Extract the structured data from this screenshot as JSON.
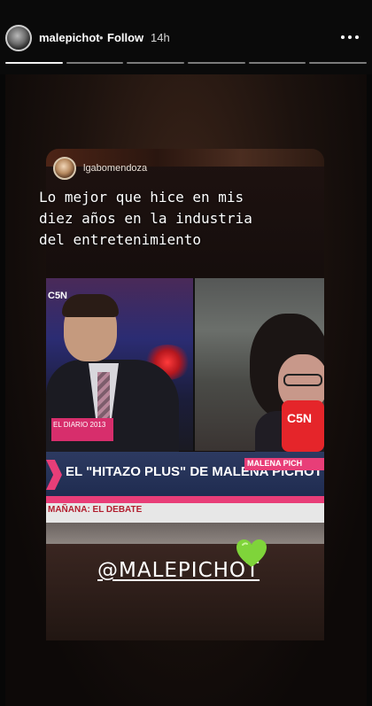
{
  "header": {
    "username": "malepichot",
    "separator": "•",
    "follow_label": "Follow",
    "time_ago": "14h",
    "more_icon": "ellipsis-horizontal-icon"
  },
  "progress": {
    "segments": 6,
    "active_index": 0
  },
  "story": {
    "shared_post": {
      "username": "lgabomendoza",
      "caption_lines": [
        "Lo mejor que hice en mis",
        "diez años en la industria",
        "del entretenimiento"
      ]
    },
    "tv": {
      "channel_logo": "C5N",
      "mic_logo": "C5N",
      "date_label": "EL DIARIO 2013",
      "name_label": "MALENA PICH",
      "headline": "EL \"HITAZO PLUS\" DE MALENA PICHOT",
      "ticker": "MAÑANA: EL DEBATE"
    },
    "mention": "@MALEPICHOT",
    "sticker": "green-heart-icon",
    "colors": {
      "heart": "#7fd43a",
      "accent_pink": "#e83e78"
    }
  }
}
